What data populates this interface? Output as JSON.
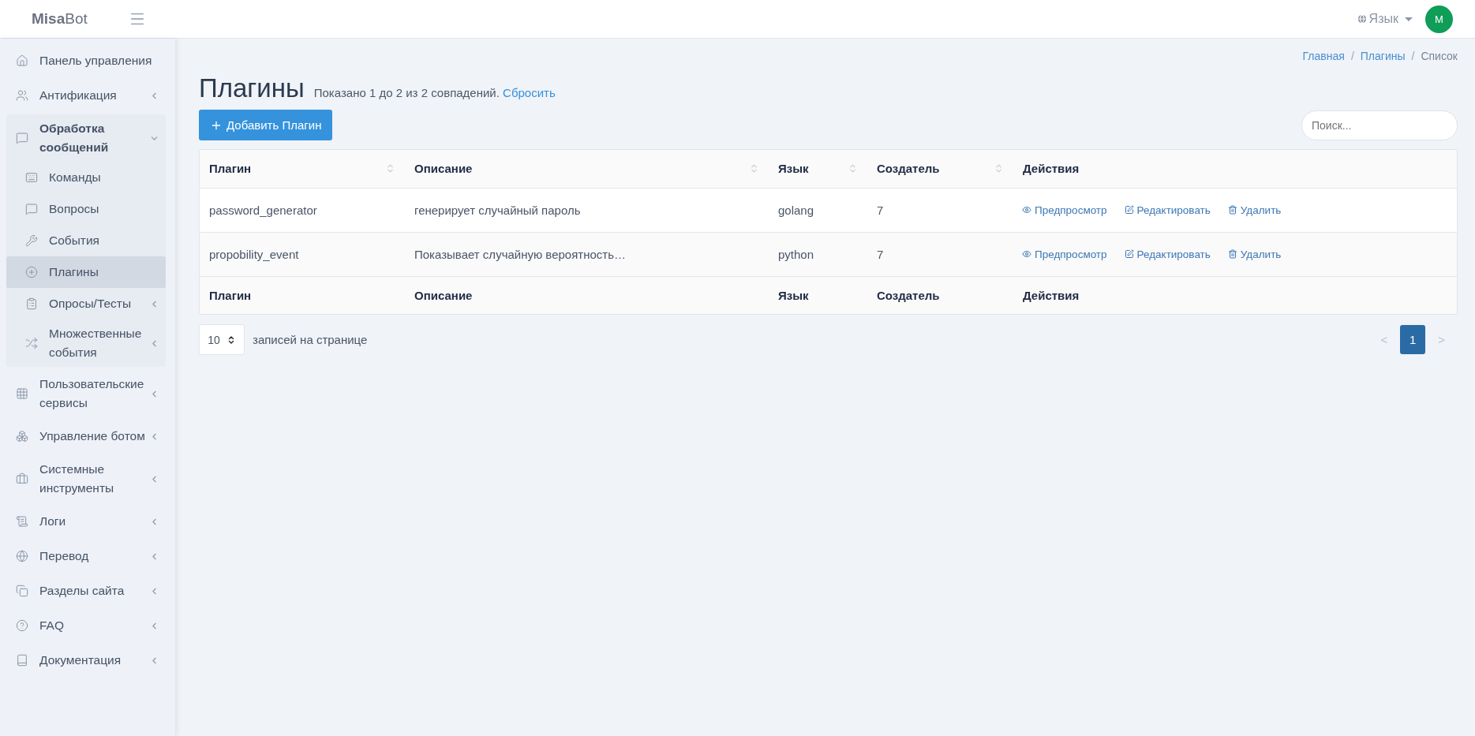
{
  "header": {
    "logo_bold": "Misa",
    "logo_rest": "Bot",
    "language": "Язык",
    "avatar": "M"
  },
  "sidebar": {
    "items": [
      {
        "label": "Панель управления",
        "selected": false
      },
      {
        "label": "Антификация",
        "selected": false,
        "expanded": false
      },
      {
        "label": "Обработка сообщений",
        "selected": false,
        "expanded": true,
        "children": [
          {
            "label": "Команды",
            "selected": false
          },
          {
            "label": "Вопросы",
            "selected": false
          },
          {
            "label": "События",
            "selected": false
          },
          {
            "label": "Плагины",
            "selected": true
          },
          {
            "label": "Опросы/Тесты",
            "selected": false,
            "expanded": false
          },
          {
            "label": "Множественные события",
            "selected": false,
            "expanded": false
          }
        ]
      },
      {
        "label": "Пользовательские сервисы",
        "selected": false,
        "expanded": false
      },
      {
        "label": "Управление ботом",
        "selected": false,
        "expanded": false
      },
      {
        "label": "Системные инструменты",
        "selected": false,
        "expanded": false
      },
      {
        "label": "Логи",
        "selected": false,
        "expanded": false
      },
      {
        "label": "Перевод",
        "selected": false,
        "expanded": false
      },
      {
        "label": "Разделы сайта",
        "selected": false,
        "expanded": false
      },
      {
        "label": "FAQ",
        "selected": false,
        "expanded": false
      },
      {
        "label": "Документация",
        "selected": false,
        "expanded": false
      }
    ]
  },
  "breadcrumb": [
    {
      "kind": "link",
      "label": "Главная"
    },
    {
      "kind": "separator",
      "label": "/"
    },
    {
      "kind": "link",
      "label": "Плагины"
    },
    {
      "kind": "separator",
      "label": "/"
    },
    {
      "kind": "current",
      "label": "Список"
    }
  ],
  "page": {
    "title": "Плагины",
    "summary": "Показано 1 до 2 из 2 совпадений.",
    "reset": "Сбросить",
    "add_button": "Добавить Плагин",
    "search": {
      "placeholder": "Поиск..."
    }
  },
  "table": {
    "columns": [
      {
        "label": "Плагин",
        "sortable": true
      },
      {
        "label": "Описание",
        "sortable": true
      },
      {
        "label": "Язык",
        "sortable": true
      },
      {
        "label": "Создатель",
        "sortable": true
      },
      {
        "label": "Действия",
        "sortable": false
      }
    ],
    "rows": [
      {
        "plugin": "password_generator",
        "description": "генерирует случайный пароль",
        "language": "golang",
        "creator": "7",
        "actions": [
          "Предпросмотр",
          "Редактировать",
          "Удалить"
        ]
      },
      {
        "plugin": "propobility_event",
        "description": "Показывает случайную вероятность…",
        "language": "python",
        "creator": "7",
        "actions": [
          "Предпросмотр",
          "Редактировать",
          "Удалить"
        ]
      }
    ],
    "footer": [
      "Плагин",
      "Описание",
      "Язык",
      "Создатель",
      "Действия"
    ]
  },
  "page_size": {
    "value": "10",
    "label": "записей на странице"
  },
  "pagination": [
    {
      "label": "<",
      "selected": false,
      "disabled": true
    },
    {
      "label": "1",
      "selected": true,
      "disabled": false
    },
    {
      "label": ">",
      "selected": false,
      "disabled": true
    }
  ]
}
